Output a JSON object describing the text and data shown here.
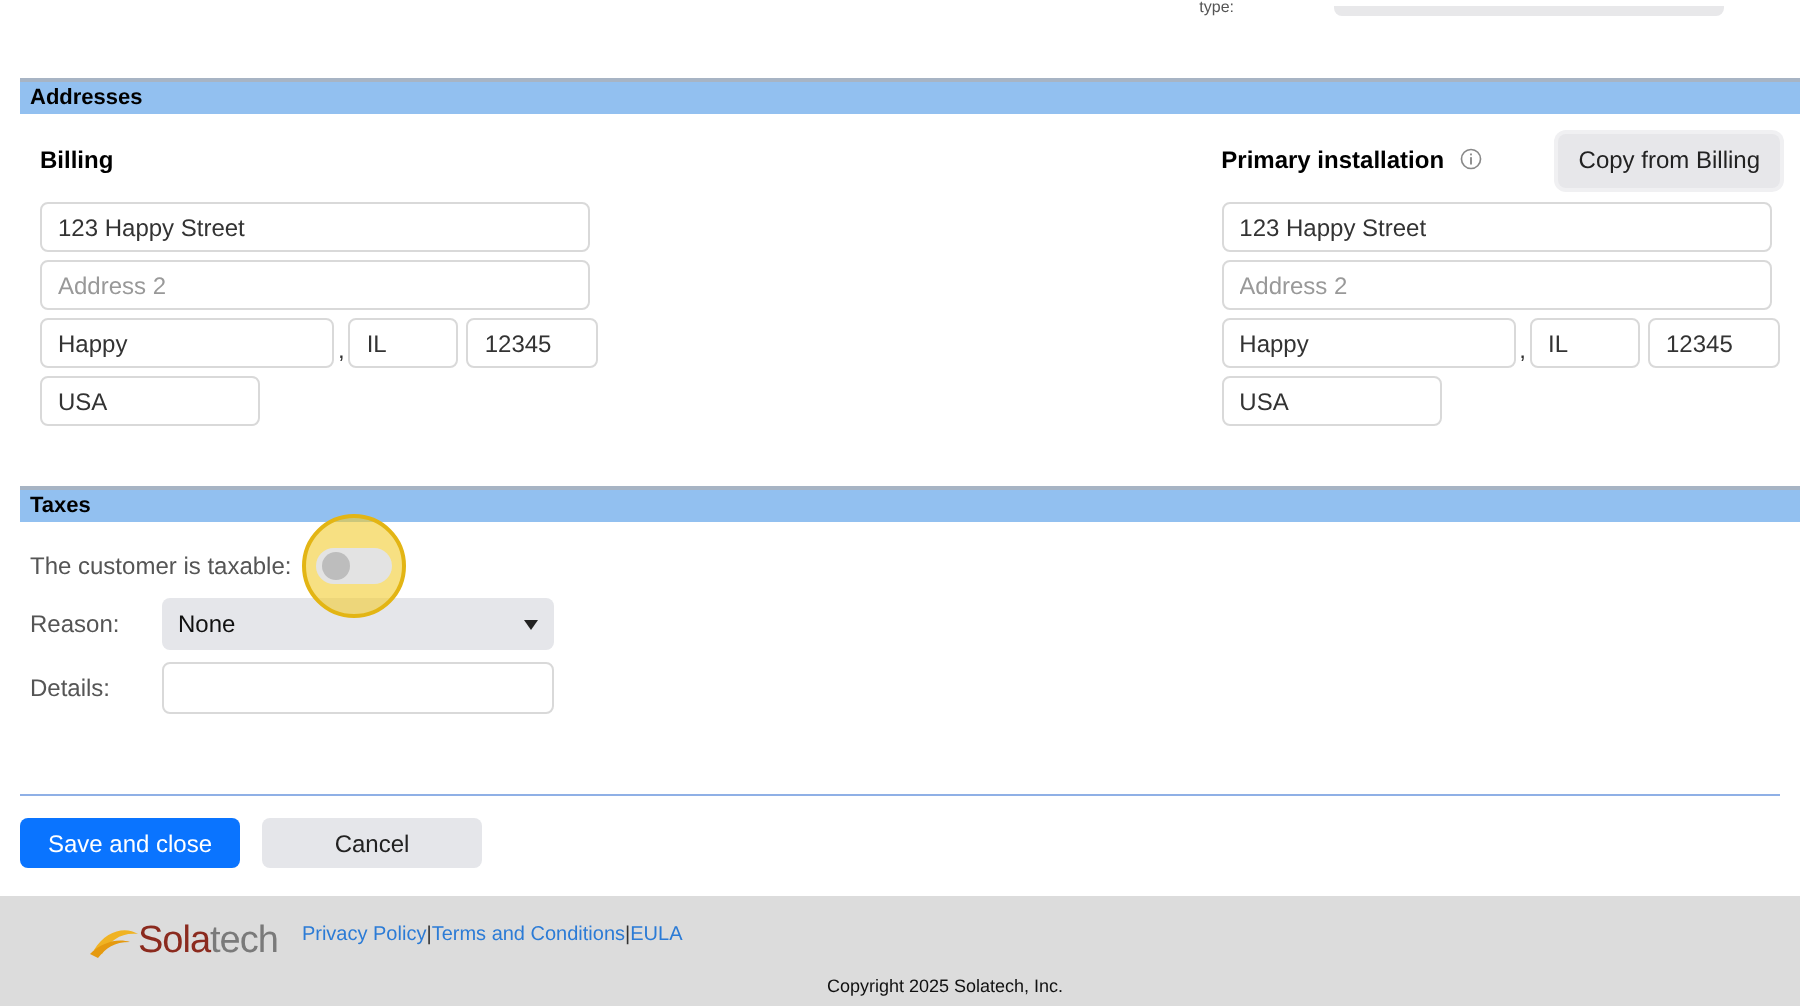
{
  "top_field": {
    "label": "type:"
  },
  "addresses": {
    "title": "Addresses",
    "billing": {
      "title": "Billing",
      "street": "123 Happy Street",
      "address2_placeholder": "Address 2",
      "city": "Happy",
      "separator": ",",
      "state": "IL",
      "zip": "12345",
      "country": "USA"
    },
    "installation": {
      "title": "Primary installation",
      "copy_button": "Copy from Billing",
      "street": "123 Happy Street",
      "address2_placeholder": "Address 2",
      "city": "Happy",
      "separator": ",",
      "state": "IL",
      "zip": "12345",
      "country": "USA"
    }
  },
  "taxes": {
    "title": "Taxes",
    "taxable_label": "The customer is taxable:",
    "taxable_on": false,
    "click_highlight": true,
    "reason_label": "Reason:",
    "reason_value": "None",
    "details_label": "Details:"
  },
  "buttons": [
    {
      "label": "Save and close",
      "kind": "primary"
    },
    {
      "label": "Cancel",
      "kind": "secondary"
    }
  ],
  "footer": {
    "logo": [
      {
        "text": "Sola",
        "color": "#8b2a1e"
      },
      {
        "text": "tech",
        "color": "#7a7a7a"
      }
    ],
    "links": [
      "Privacy Policy",
      "Terms and Conditions",
      "EULA"
    ],
    "link_separator": "|",
    "copyright": "Copyright 2025 Solatech, Inc."
  }
}
